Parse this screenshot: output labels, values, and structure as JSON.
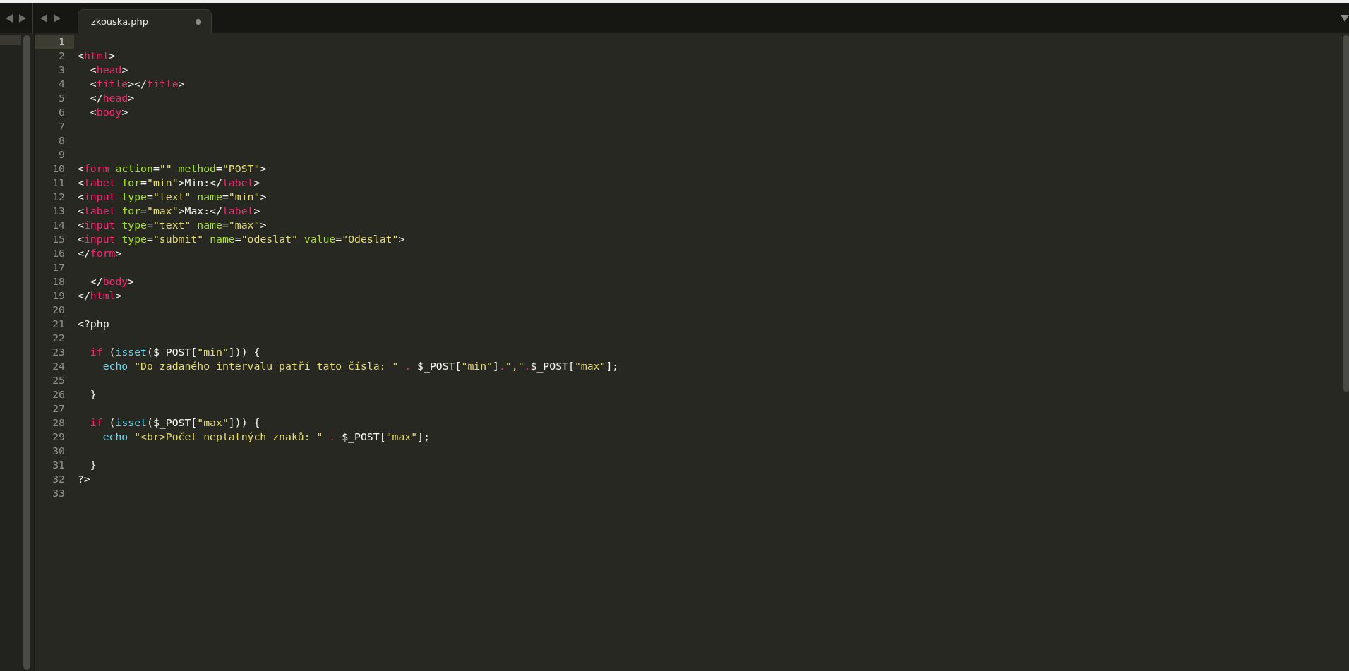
{
  "tab": {
    "title": "zkouska.php",
    "modified": true,
    "selected": true
  },
  "lines": [
    {
      "number": "1",
      "current": true
    },
    {
      "number": "2",
      "current": false,
      "tokens": [
        {
          "text": "<",
          "kind": "punctuation"
        },
        {
          "text": "html",
          "kind": "tag"
        },
        {
          "text": ">",
          "kind": "punctuation"
        }
      ]
    },
    {
      "number": "3",
      "current": false,
      "tokens": [
        {
          "text": "  <",
          "kind": "punctuation"
        },
        {
          "text": "head",
          "kind": "tag"
        },
        {
          "text": ">",
          "kind": "punctuation"
        }
      ]
    },
    {
      "number": "4",
      "current": false,
      "tokens": [
        {
          "text": "  <",
          "kind": "punctuation"
        },
        {
          "text": "title",
          "kind": "tag"
        },
        {
          "text": "></",
          "kind": "punctuation"
        },
        {
          "text": "title",
          "kind": "tag"
        },
        {
          "text": ">",
          "kind": "punctuation"
        }
      ]
    },
    {
      "number": "5",
      "current": false,
      "tokens": [
        {
          "text": "  </",
          "kind": "punctuation"
        },
        {
          "text": "head",
          "kind": "tag"
        },
        {
          "text": ">",
          "kind": "punctuation"
        }
      ]
    },
    {
      "number": "6",
      "current": false,
      "tokens": [
        {
          "text": "  <",
          "kind": "punctuation"
        },
        {
          "text": "body",
          "kind": "tag"
        },
        {
          "text": ">",
          "kind": "punctuation"
        }
      ]
    },
    {
      "number": "7",
      "current": false
    },
    {
      "number": "8",
      "current": false
    },
    {
      "number": "9",
      "current": false
    },
    {
      "number": "10",
      "current": false,
      "tokens": [
        {
          "text": "<",
          "kind": "punctuation"
        },
        {
          "text": "form",
          "kind": "tag"
        },
        {
          "text": " action",
          "kind": "attribute"
        },
        {
          "text": "=",
          "kind": "punctuation"
        },
        {
          "text": "\"\"",
          "kind": "string"
        },
        {
          "text": " method",
          "kind": "attribute"
        },
        {
          "text": "=",
          "kind": "punctuation"
        },
        {
          "text": "\"POST\"",
          "kind": "string"
        },
        {
          "text": ">",
          "kind": "punctuation"
        }
      ]
    },
    {
      "number": "11",
      "current": false,
      "tokens": [
        {
          "text": "<",
          "kind": "punctuation"
        },
        {
          "text": "label",
          "kind": "tag"
        },
        {
          "text": " for",
          "kind": "attribute"
        },
        {
          "text": "=",
          "kind": "punctuation"
        },
        {
          "text": "\"min\"",
          "kind": "string"
        },
        {
          "text": ">Min:</",
          "kind": "punctuation"
        },
        {
          "text": "label",
          "kind": "tag"
        },
        {
          "text": ">",
          "kind": "punctuation"
        }
      ]
    },
    {
      "number": "12",
      "current": false,
      "tokens": [
        {
          "text": "<",
          "kind": "punctuation"
        },
        {
          "text": "input",
          "kind": "tag"
        },
        {
          "text": " type",
          "kind": "attribute"
        },
        {
          "text": "=",
          "kind": "punctuation"
        },
        {
          "text": "\"text\"",
          "kind": "string"
        },
        {
          "text": " name",
          "kind": "attribute"
        },
        {
          "text": "=",
          "kind": "punctuation"
        },
        {
          "text": "\"min\"",
          "kind": "string"
        },
        {
          "text": ">",
          "kind": "punctuation"
        }
      ]
    },
    {
      "number": "13",
      "current": false,
      "tokens": [
        {
          "text": "<",
          "kind": "punctuation"
        },
        {
          "text": "label",
          "kind": "tag"
        },
        {
          "text": " for",
          "kind": "attribute"
        },
        {
          "text": "=",
          "kind": "punctuation"
        },
        {
          "text": "\"max\"",
          "kind": "string"
        },
        {
          "text": ">Max:</",
          "kind": "punctuation"
        },
        {
          "text": "label",
          "kind": "tag"
        },
        {
          "text": ">",
          "kind": "punctuation"
        }
      ]
    },
    {
      "number": "14",
      "current": false,
      "tokens": [
        {
          "text": "<",
          "kind": "punctuation"
        },
        {
          "text": "input",
          "kind": "tag"
        },
        {
          "text": " type",
          "kind": "attribute"
        },
        {
          "text": "=",
          "kind": "punctuation"
        },
        {
          "text": "\"text\"",
          "kind": "string"
        },
        {
          "text": " name",
          "kind": "attribute"
        },
        {
          "text": "=",
          "kind": "punctuation"
        },
        {
          "text": "\"max\"",
          "kind": "string"
        },
        {
          "text": ">",
          "kind": "punctuation"
        }
      ]
    },
    {
      "number": "15",
      "current": false,
      "tokens": [
        {
          "text": "<",
          "kind": "punctuation"
        },
        {
          "text": "input",
          "kind": "tag"
        },
        {
          "text": " type",
          "kind": "attribute"
        },
        {
          "text": "=",
          "kind": "punctuation"
        },
        {
          "text": "\"submit\"",
          "kind": "string"
        },
        {
          "text": " name",
          "kind": "attribute"
        },
        {
          "text": "=",
          "kind": "punctuation"
        },
        {
          "text": "\"odeslat\"",
          "kind": "string"
        },
        {
          "text": " value",
          "kind": "attribute"
        },
        {
          "text": "=",
          "kind": "punctuation"
        },
        {
          "text": "\"Odeslat\"",
          "kind": "string"
        },
        {
          "text": ">",
          "kind": "punctuation"
        }
      ]
    },
    {
      "number": "16",
      "current": false,
      "tokens": [
        {
          "text": "</",
          "kind": "punctuation"
        },
        {
          "text": "form",
          "kind": "tag"
        },
        {
          "text": ">",
          "kind": "punctuation"
        }
      ]
    },
    {
      "number": "17",
      "current": false
    },
    {
      "number": "18",
      "current": false,
      "tokens": [
        {
          "text": "  </",
          "kind": "punctuation"
        },
        {
          "text": "body",
          "kind": "tag"
        },
        {
          "text": ">",
          "kind": "punctuation"
        }
      ]
    },
    {
      "number": "19",
      "current": false,
      "tokens": [
        {
          "text": "</",
          "kind": "punctuation"
        },
        {
          "text": "html",
          "kind": "tag"
        },
        {
          "text": ">",
          "kind": "punctuation"
        }
      ]
    },
    {
      "number": "20",
      "current": false
    },
    {
      "number": "21",
      "current": false,
      "tokens": [
        {
          "text": "<?php",
          "kind": "punctuation"
        }
      ]
    },
    {
      "number": "22",
      "current": false
    },
    {
      "number": "23",
      "current": false,
      "tokens": [
        {
          "text": "  if",
          "kind": "keyword"
        },
        {
          "text": " (",
          "kind": "punctuation"
        },
        {
          "text": "isset",
          "kind": "function"
        },
        {
          "text": "($_POST[",
          "kind": "punctuation"
        },
        {
          "text": "\"min\"",
          "kind": "string"
        },
        {
          "text": "])) {",
          "kind": "punctuation"
        }
      ]
    },
    {
      "number": "24",
      "current": false,
      "tokens": [
        {
          "text": "    echo",
          "kind": "function"
        },
        {
          "text": " \"Do zadaného intervalu patří tato čísla: \"",
          "kind": "string"
        },
        {
          "text": " .",
          "kind": "keyword"
        },
        {
          "text": " $_POST[",
          "kind": "punctuation"
        },
        {
          "text": "\"min\"",
          "kind": "string"
        },
        {
          "text": "]",
          "kind": "punctuation"
        },
        {
          "text": ".",
          "kind": "keyword"
        },
        {
          "text": "\",\"",
          "kind": "string"
        },
        {
          "text": ".",
          "kind": "keyword"
        },
        {
          "text": "$_POST[",
          "kind": "punctuation"
        },
        {
          "text": "\"max\"",
          "kind": "string"
        },
        {
          "text": "];",
          "kind": "punctuation"
        }
      ]
    },
    {
      "number": "25",
      "current": false
    },
    {
      "number": "26",
      "current": false,
      "tokens": [
        {
          "text": "  }",
          "kind": "punctuation"
        }
      ]
    },
    {
      "number": "27",
      "current": false
    },
    {
      "number": "28",
      "current": false,
      "tokens": [
        {
          "text": "  if",
          "kind": "keyword"
        },
        {
          "text": " (",
          "kind": "punctuation"
        },
        {
          "text": "isset",
          "kind": "function"
        },
        {
          "text": "($_POST[",
          "kind": "punctuation"
        },
        {
          "text": "\"max\"",
          "kind": "string"
        },
        {
          "text": "])) {",
          "kind": "punctuation"
        }
      ]
    },
    {
      "number": "29",
      "current": false,
      "tokens": [
        {
          "text": "    echo",
          "kind": "function"
        },
        {
          "text": " \"<br>Počet neplatných znaků: \"",
          "kind": "string"
        },
        {
          "text": " .",
          "kind": "keyword"
        },
        {
          "text": " $_POST[",
          "kind": "punctuation"
        },
        {
          "text": "\"max\"",
          "kind": "string"
        },
        {
          "text": "];",
          "kind": "punctuation"
        }
      ]
    },
    {
      "number": "30",
      "current": false
    },
    {
      "number": "31",
      "current": false,
      "tokens": [
        {
          "text": "  }",
          "kind": "punctuation"
        }
      ]
    },
    {
      "number": "32",
      "current": false,
      "tokens": [
        {
          "text": "?>",
          "kind": "punctuation"
        }
      ]
    },
    {
      "number": "33",
      "current": false
    }
  ]
}
